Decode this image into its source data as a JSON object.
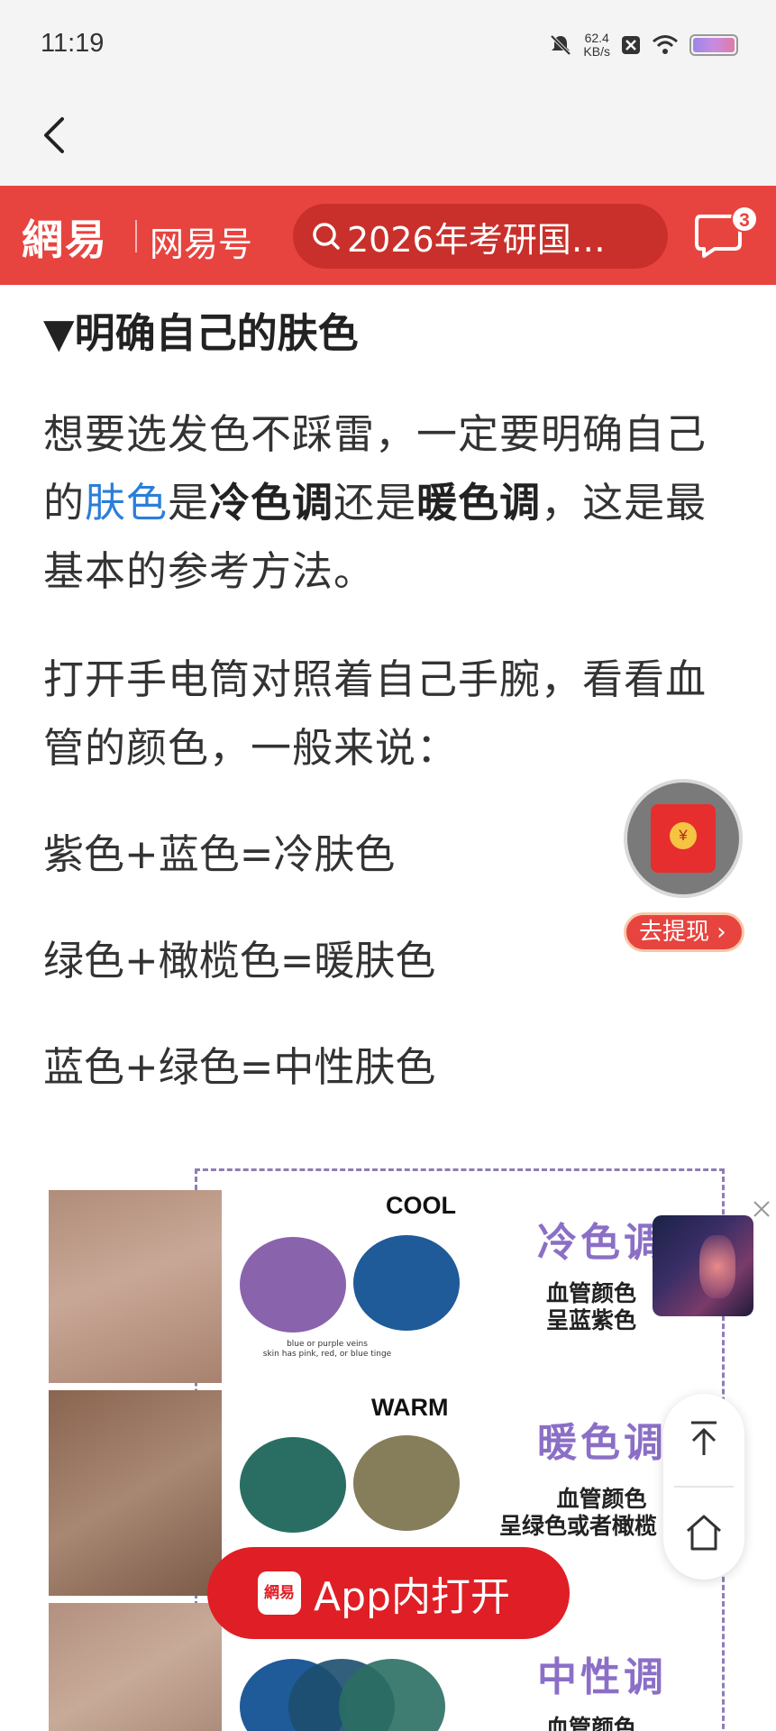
{
  "status_bar": {
    "time": "11:19",
    "net_speed_value": "62.4",
    "net_speed_unit": "KB/s",
    "icons": [
      "mute-icon",
      "notification-x-icon",
      "wifi-icon",
      "battery-icon"
    ]
  },
  "nav": {
    "back_icon": "chevron-left-icon"
  },
  "brand_bar": {
    "logo": "網易",
    "section": "网易号",
    "search_text": "2026年考研国…",
    "message_count": "3",
    "color": "#e8443f"
  },
  "article": {
    "heading": "▼明确自己的肤色",
    "p1": {
      "a": "想要选发色不踩雷，一定要明确自己的",
      "link": "肤色",
      "b": "是",
      "bold1": "冷色调",
      "c": "还是",
      "bold2": "暖色调",
      "d": "，这是最基本的参考方法。"
    },
    "p2": "打开手电筒对照着自己手腕，看看血管的颜色，一般来说：",
    "line1": "紫色+蓝色=冷肤色",
    "line2": "绿色+橄榄色=暖肤色",
    "line3": "蓝色+绿色=中性肤色"
  },
  "infographic": {
    "cool_title": "COOL",
    "cool_caption_1": "blue or purple veins",
    "cool_caption_2": "skin has pink, red, or blue tinge",
    "cool_label": "冷色调",
    "cool_desc_1": "血管颜色",
    "cool_desc_2": "呈蓝紫色",
    "warm_title": "WARM",
    "warm_label": "暖色调",
    "warm_desc_1": "血管颜色",
    "warm_desc_2": "呈绿色或者橄榄",
    "neutral_label": "中性调",
    "neutral_desc_1": "血管颜色",
    "colors": {
      "purple": "#8a63ad",
      "blue": "#1f5a99",
      "teal": "#2a6e63",
      "olive": "#867d5a"
    }
  },
  "floating": {
    "red_packet_icon": "red-packet-icon",
    "withdraw_label": "去提现 ›",
    "open_app_badge": "網易",
    "open_app_label": "App内打开",
    "tool_icons": [
      "back-to-top-icon",
      "home-icon"
    ]
  }
}
